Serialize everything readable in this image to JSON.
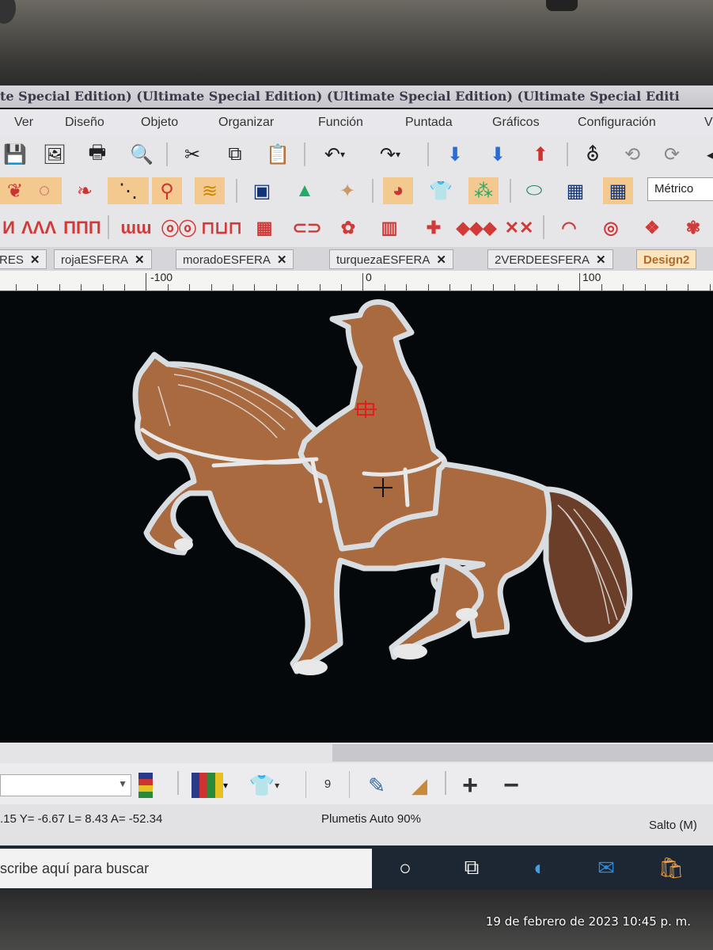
{
  "window": {
    "title": "te Special Edition) (Ultimate Special Edition) (Ultimate Special Edition) (Ultimate Special Editi"
  },
  "menu": {
    "items": [
      "Ver",
      "Diseño",
      "Objeto",
      "Organizar",
      "Función",
      "Puntada",
      "Gráficos",
      "Configuración",
      "V"
    ]
  },
  "toolbar": {
    "units_label": "Métrico"
  },
  "tabs": [
    {
      "label": "RES"
    },
    {
      "label": "rojaESFERA"
    },
    {
      "label": "moradoESFERA"
    },
    {
      "label": "turquezaESFERA"
    },
    {
      "label": "2VERDEESFERA"
    },
    {
      "label": "Design2"
    }
  ],
  "ruler": {
    "labels": [
      "-100",
      "0",
      "100"
    ]
  },
  "bottom": {
    "spin_value": "9"
  },
  "status": {
    "coords": ".15 Y=  -6.67 L=   8.43 A=  -52.34",
    "stitch_type": "Plumetis Auto 90%",
    "mode": "Salto (M)"
  },
  "taskbar": {
    "search_placeholder": "scribe aquí para buscar"
  },
  "photo": {
    "timestamp": "19 de febrero de 2023 10:45 p. m."
  },
  "colors": {
    "design_fill": "#a86a3e",
    "design_outline": "#d8dde2",
    "canvas_bg": "#05080a",
    "highlight": "#f4c98f",
    "active_tab_text": "#b06a2a"
  }
}
